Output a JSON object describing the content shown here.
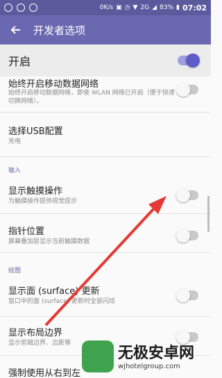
{
  "status_bar": {
    "network_speed": "0K/s",
    "signal_label": "2G",
    "battery": "83%",
    "time": "07:02"
  },
  "app_bar": {
    "title": "开发者选项"
  },
  "master": {
    "label": "开启",
    "enabled": true
  },
  "rows": [
    {
      "title": "始终开启移动数据网络",
      "subtitle": "始终开启移动数据网络，即使 WLAN 网络已开启（便于快速切换网络）。",
      "toggle": false
    },
    {
      "title": "选择USB配置",
      "subtitle": "充电"
    },
    {
      "title": "显示触摸操作",
      "subtitle": "为触摸操作提供视觉提示",
      "toggle": false
    },
    {
      "title": "指针位置",
      "subtitle": "屏幕叠加层显示当前触摸数据",
      "toggle": false
    },
    {
      "title": "显示面 (surface) 更新",
      "subtitle": "窗口中的面 (surface) 更新时全部闪烁",
      "toggle": false
    },
    {
      "title": "显示布局边界",
      "subtitle": "显示剪辑边界、边距等",
      "toggle": false
    },
    {
      "title": "强制使用从右到左"
    }
  ],
  "sections": {
    "input": "输入",
    "drawing": "绘图"
  },
  "colors": {
    "status_bar": "#5c5a9c",
    "app_bar": "#6a68b0",
    "accent": "#5e5cc8",
    "arrow": "#e53935"
  },
  "watermark": {
    "title": "无极安卓网",
    "url": "wjhotelgroup.com"
  }
}
